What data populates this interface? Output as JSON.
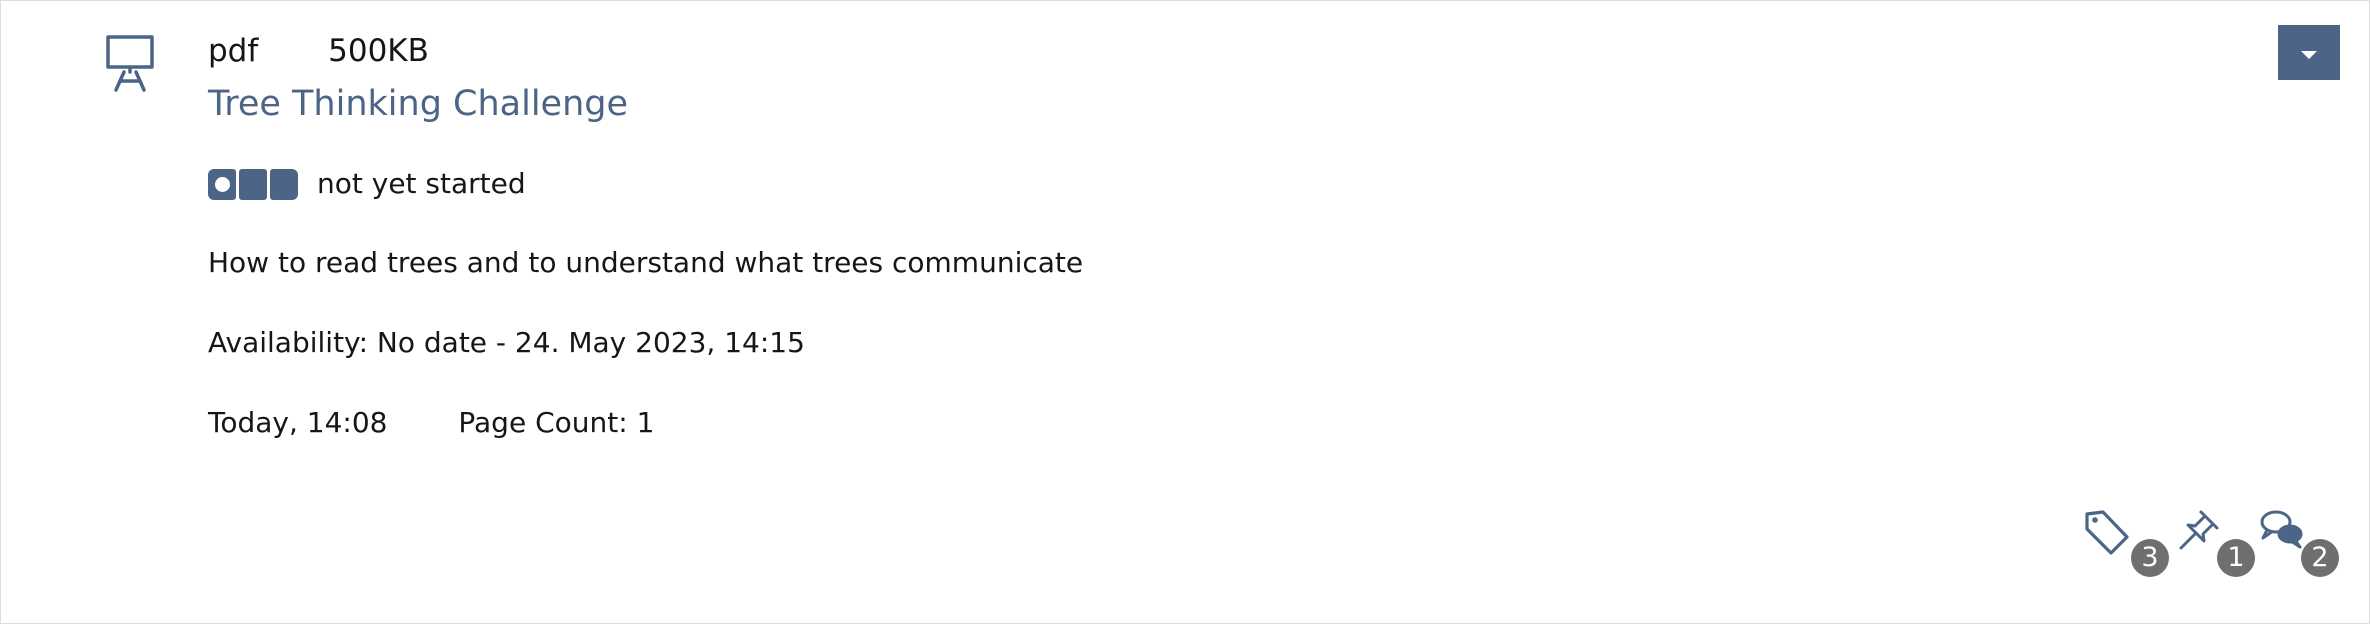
{
  "item": {
    "type_icon": "presentation-board-icon",
    "file_type": "pdf",
    "file_size": "500KB",
    "title": "Tree Thinking Challenge",
    "progress": {
      "label": "not yet started",
      "steps_total": 3,
      "status": "not-started"
    },
    "description": "How to read trees and to understand what trees communicate",
    "availability": "Availability: No date - 24. May 2023, 14:15",
    "last_update": "Today, 14:08",
    "page_count": "Page Count: 1"
  },
  "actions": {
    "dropdown_icon": "caret-down-icon",
    "tags": {
      "icon": "tag-icon",
      "count": "3"
    },
    "notes": {
      "icon": "pin-icon",
      "count": "1"
    },
    "comments": {
      "icon": "comment-bubbles-icon",
      "count": "2"
    }
  },
  "colors": {
    "accent": "#4c6586",
    "badge": "#6f6f6f",
    "text": "#161616",
    "border": "#dddddd"
  }
}
